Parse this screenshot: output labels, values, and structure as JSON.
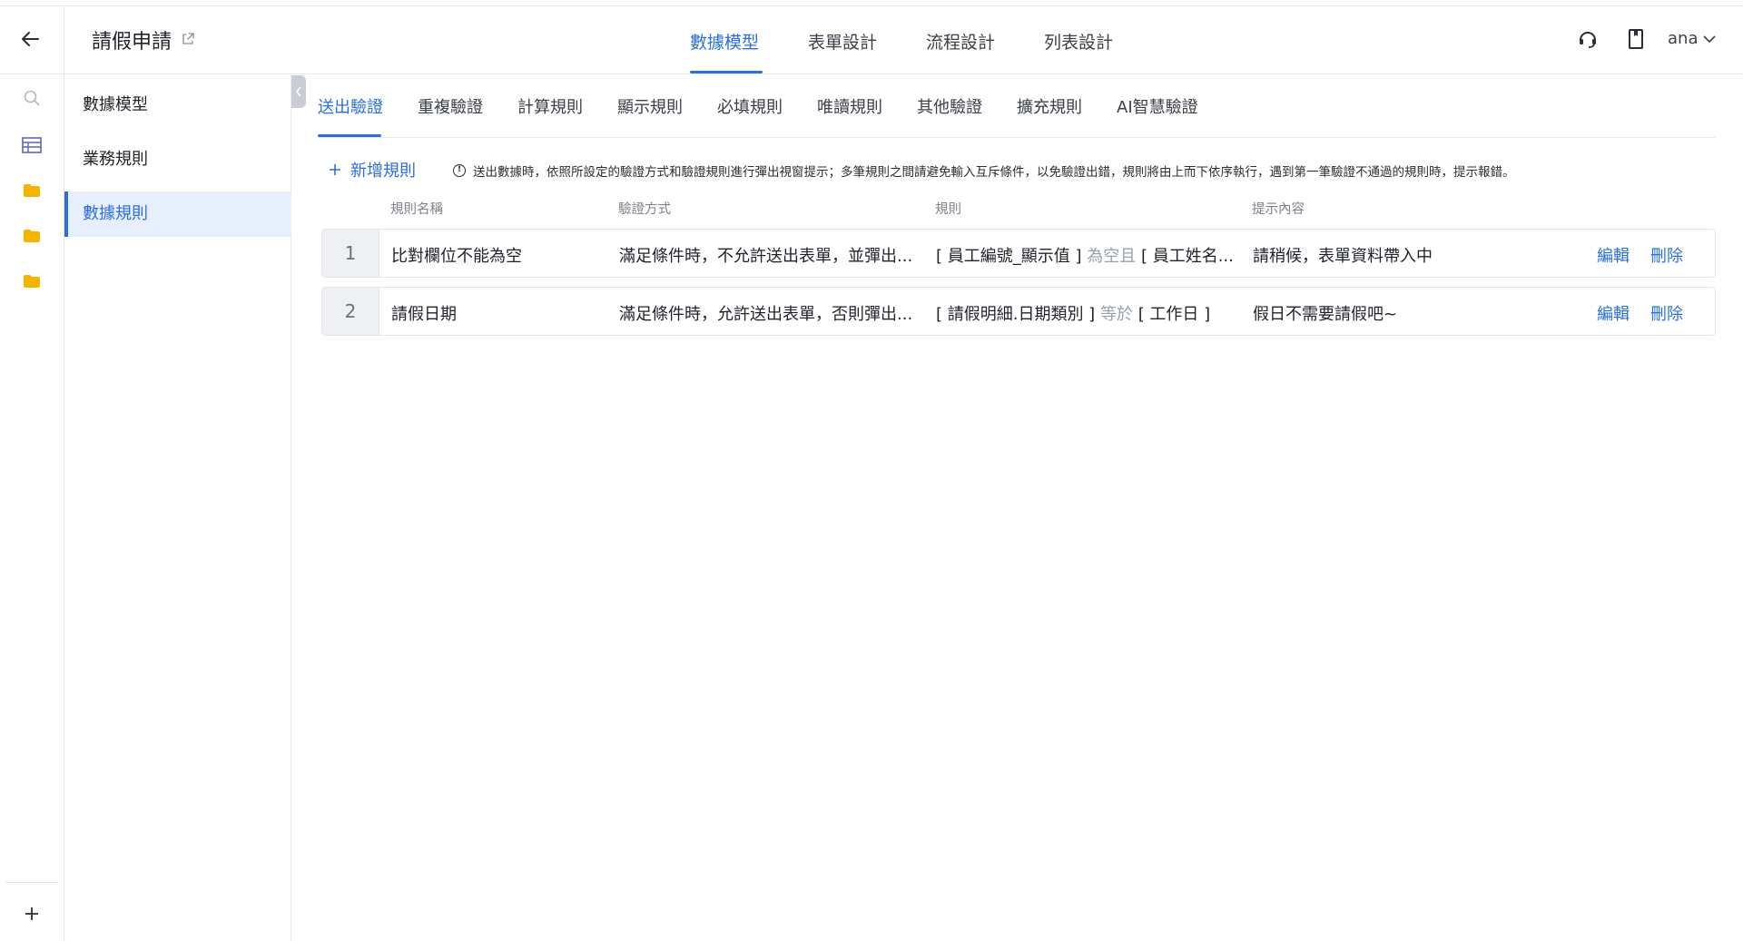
{
  "header": {
    "back_icon": "arrow-left-icon",
    "app_title": "請假申請",
    "external_link_icon": "external-link-icon",
    "tabs": [
      "數據模型",
      "表單設計",
      "流程設計",
      "列表設計"
    ],
    "active_tab": "數據模型",
    "support_icon": "headset-icon",
    "doc_icon": "book-icon",
    "user_name": "ana",
    "accent_color": "#2b6fdb"
  },
  "rail": {
    "icons": [
      "search-icon",
      "table-icon",
      "folder-icon",
      "folder-icon",
      "folder-icon"
    ],
    "folder_color": "#f5b400",
    "add_icon": "plus-icon"
  },
  "subnav": {
    "items": [
      "數據模型",
      "業務規則",
      "數據規則"
    ],
    "active_item": "數據規則"
  },
  "rule_tabs": {
    "items": [
      "送出驗證",
      "重複驗證",
      "計算規則",
      "顯示規則",
      "必填規則",
      "唯讀規則",
      "其他驗證",
      "擴充規則",
      "AI智慧驗證"
    ],
    "active_item": "送出驗證"
  },
  "toolbar": {
    "add_rule_label": "新增規則",
    "info_text": "送出數據時，依照所設定的驗證方式和驗證規則進行彈出視窗提示；多筆規則之間請避免輸入互斥條件，以免驗證出錯，規則將由上而下依序執行，遇到第一筆驗證不通過的規則時，提示報錯。"
  },
  "table": {
    "columns": [
      "規則名稱",
      "驗證方式",
      "規則",
      "提示內容"
    ],
    "rows": [
      {
        "index": "1",
        "name": "比對欄位不能為空",
        "method": "滿足條件時，不允許送出表單，並彈出...",
        "rule_field": "[ 員工編號_顯示值 ]",
        "rule_op": "為空且",
        "rule_value": "[ 員工姓名...",
        "message": "請稍候，表單資料帶入中",
        "edit_label": "編輯",
        "delete_label": "刪除"
      },
      {
        "index": "2",
        "name": "請假日期",
        "method": "滿足條件時，允許送出表單，否則彈出...",
        "rule_field": "[ 請假明細.日期類別 ]",
        "rule_op": "等於",
        "rule_value": "[ 工作日 ]",
        "message": "假日不需要請假吧~",
        "edit_label": "編輯",
        "delete_label": "刪除"
      }
    ]
  }
}
